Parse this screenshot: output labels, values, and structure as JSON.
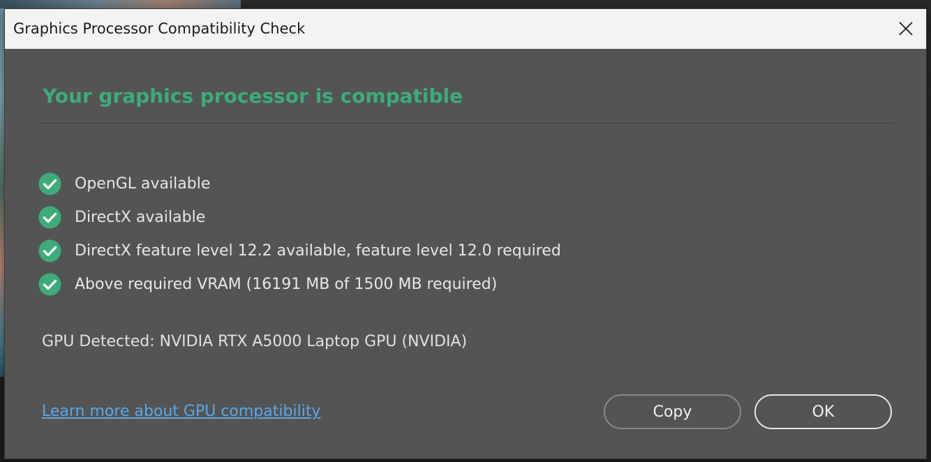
{
  "window": {
    "title": "Graphics Processor Compatibility Check",
    "close_icon": "close-icon"
  },
  "status": {
    "heading": "Your graphics processor is compatible",
    "color": "#3dab7a"
  },
  "checks": [
    {
      "label": "OpenGL available",
      "icon": "check-circle-icon",
      "passed": true
    },
    {
      "label": "DirectX available",
      "icon": "check-circle-icon",
      "passed": true
    },
    {
      "label": "DirectX feature level 12.2 available, feature level 12.0 required",
      "icon": "check-circle-icon",
      "passed": true
    },
    {
      "label": "Above required VRAM (16191 MB of 1500 MB required)",
      "icon": "check-circle-icon",
      "passed": true
    }
  ],
  "gpu": {
    "detected_text": "GPU Detected: NVIDIA RTX A5000 Laptop GPU (NVIDIA)"
  },
  "footer": {
    "learn_more_link": "Learn more about GPU compatibility",
    "copy_label": "Copy",
    "ok_label": "OK"
  },
  "colors": {
    "dialog_bg": "#545454",
    "titlebar_bg": "#f3f3f3",
    "success_green": "#3dab7a",
    "link_blue": "#5aa7e8"
  }
}
